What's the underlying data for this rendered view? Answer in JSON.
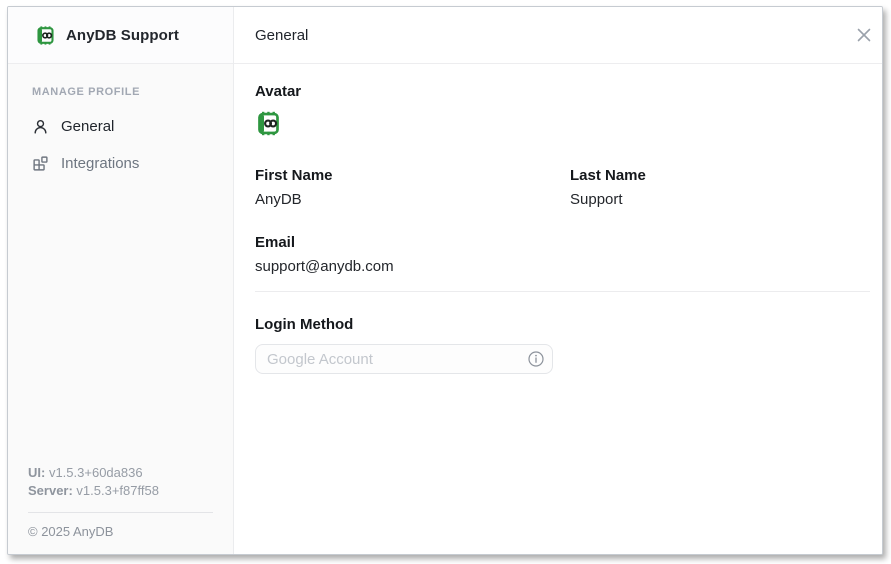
{
  "sidebar": {
    "app_title": "AnyDB Support",
    "section_label": "MANAGE PROFILE",
    "items": [
      {
        "label": "General",
        "icon": "user-icon",
        "active": true
      },
      {
        "label": "Integrations",
        "icon": "blocks-icon",
        "active": false
      }
    ],
    "footer": {
      "ui_label": "UI:",
      "ui_version": " v1.5.3+60da836",
      "server_label": "Server:",
      "server_version": " v1.5.3+f87ff58",
      "copyright": "© 2025 AnyDB"
    }
  },
  "header": {
    "title": "General"
  },
  "profile": {
    "avatar_label": "Avatar",
    "first_name": {
      "label": "First Name",
      "value": "AnyDB"
    },
    "last_name": {
      "label": "Last Name",
      "value": "Support"
    },
    "email": {
      "label": "Email",
      "value": "support@anydb.com"
    },
    "login": {
      "label": "Login Method",
      "placeholder": "Google Account"
    }
  },
  "colors": {
    "brand_green": "#2e9640",
    "ink": "#1f242b",
    "muted_gray": "#9aa1ab"
  }
}
